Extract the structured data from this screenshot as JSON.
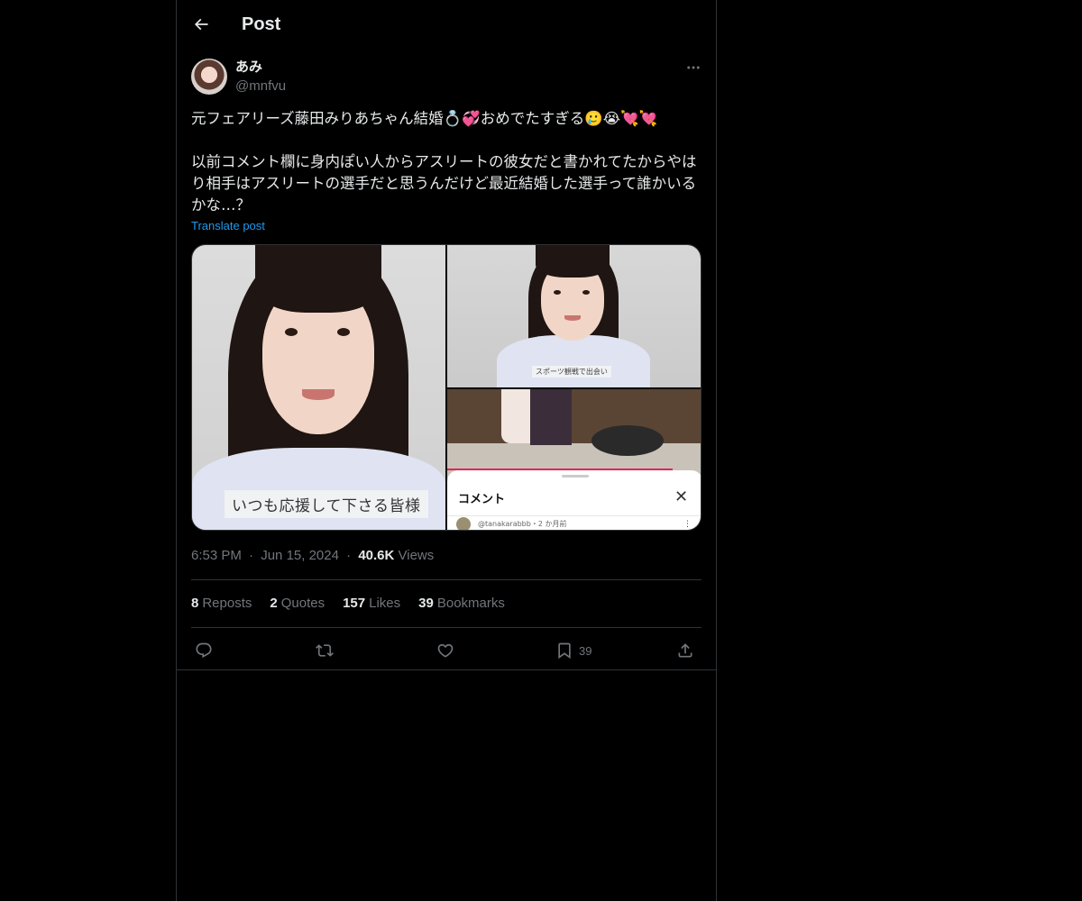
{
  "header": {
    "title": "Post",
    "back_icon": "arrow-left-icon"
  },
  "author": {
    "display_name": "あみ",
    "handle": "@mnfvu",
    "more_icon": "more-horizontal-icon"
  },
  "post": {
    "text": "元フェアリーズ藤田みりあちゃん結婚💍💞おめでたすぎる🥲😭💘💘\n\n以前コメント欄に身内ぽい人からアスリートの彼女だと書かれてたからやはり相手はアスリートの選手だと思うんだけど最近結婚した選手って誰かいるかな…？",
    "translate_label": "Translate post"
  },
  "media": {
    "caption_left": "いつも応援して下さる皆様",
    "caption_top_right": "スポーツ観戦で出会い",
    "comments_title": "コメント",
    "comments_close": "✕",
    "comments_user": "@tanakarabbb・2 か月前",
    "comments_kebab": "⋮"
  },
  "meta": {
    "time": "6:53 PM",
    "sep1": "·",
    "date": "Jun 15, 2024",
    "sep2": "·",
    "views_count": "40.6K",
    "views_label": "Views"
  },
  "stats": {
    "reposts_count": "8",
    "reposts_label": "Reposts",
    "quotes_count": "2",
    "quotes_label": "Quotes",
    "likes_count": "157",
    "likes_label": "Likes",
    "bookmarks_count": "39",
    "bookmarks_label": "Bookmarks"
  },
  "actions": {
    "reply_icon": "reply-icon",
    "repost_icon": "repost-icon",
    "like_icon": "heart-icon",
    "bookmark_icon": "bookmark-icon",
    "bookmark_count": "39",
    "share_icon": "share-icon"
  },
  "colors": {
    "background": "#000000",
    "text_primary": "#e7e9ea",
    "text_secondary": "#71767b",
    "link": "#1d9bf0",
    "border": "#2f3336"
  }
}
